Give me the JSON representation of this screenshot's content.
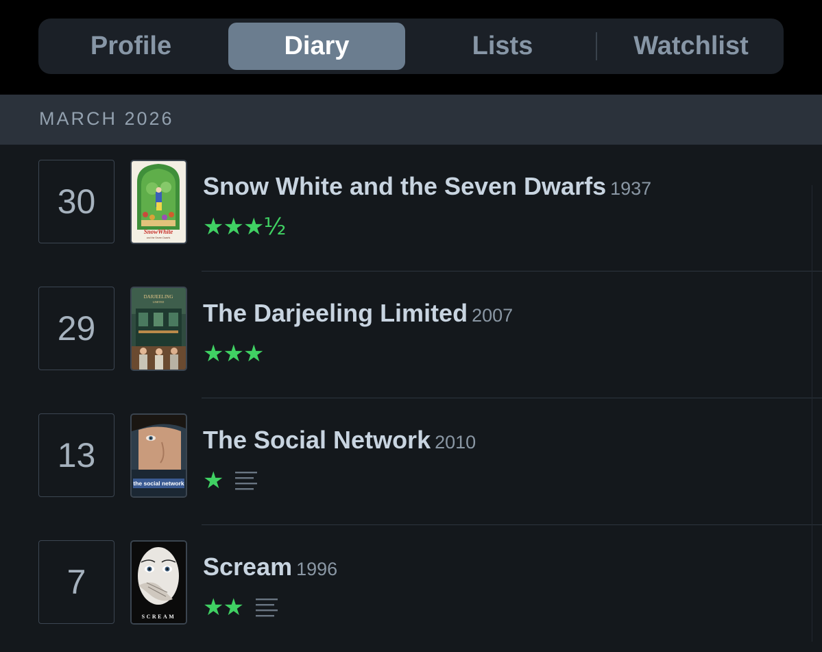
{
  "tabs": {
    "profile": "Profile",
    "diary": "Diary",
    "lists": "Lists",
    "watchlist": "Watchlist"
  },
  "month_header": "MARCH 2026",
  "entries": [
    {
      "day": "30",
      "title": "Snow White and the Seven Dwarfs",
      "year": "1937",
      "stars": "★★★½",
      "rating": 3.5,
      "has_review": false
    },
    {
      "day": "29",
      "title": "The Darjeeling Limited",
      "year": "2007",
      "stars": "★★★",
      "rating": 3,
      "has_review": false
    },
    {
      "day": "13",
      "title": "The Social Network",
      "year": "2010",
      "stars": "★",
      "rating": 1,
      "has_review": true
    },
    {
      "day": "7",
      "title": "Scream",
      "year": "1996",
      "stars": "★★",
      "rating": 2,
      "has_review": true
    }
  ],
  "posters": {
    "snow_white": {
      "logo": "SnowWhite",
      "caption": "and the Seven Dwarfs"
    },
    "darjeeling": {
      "logo": "DARJEELING",
      "sub": "LIMITED"
    },
    "social_network": {
      "logo": "the social network"
    },
    "scream": {
      "logo": "SCREAM"
    }
  },
  "colors": {
    "background": "#14181c",
    "star_green": "#40d163",
    "active_tab": "#6b7d8f",
    "month_header_bg": "#2b323b"
  }
}
